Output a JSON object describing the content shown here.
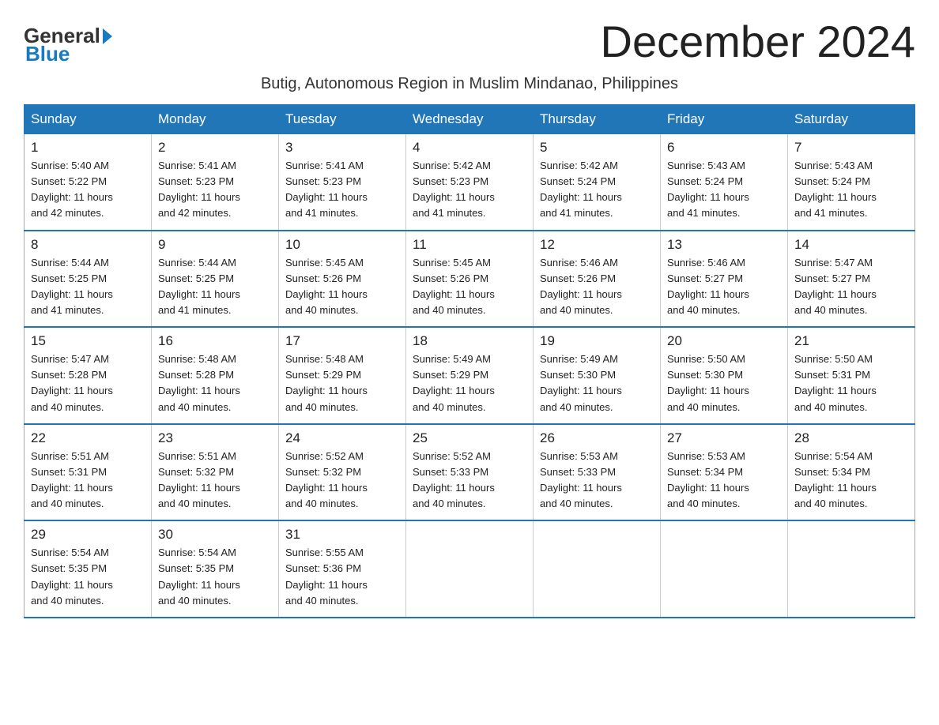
{
  "logo": {
    "general": "General",
    "blue": "Blue"
  },
  "title": "December 2024",
  "subtitle": "Butig, Autonomous Region in Muslim Mindanao, Philippines",
  "days_of_week": [
    "Sunday",
    "Monday",
    "Tuesday",
    "Wednesday",
    "Thursday",
    "Friday",
    "Saturday"
  ],
  "weeks": [
    [
      {
        "day": "1",
        "sunrise": "5:40 AM",
        "sunset": "5:22 PM",
        "daylight": "11 hours and 42 minutes."
      },
      {
        "day": "2",
        "sunrise": "5:41 AM",
        "sunset": "5:23 PM",
        "daylight": "11 hours and 42 minutes."
      },
      {
        "day": "3",
        "sunrise": "5:41 AM",
        "sunset": "5:23 PM",
        "daylight": "11 hours and 41 minutes."
      },
      {
        "day": "4",
        "sunrise": "5:42 AM",
        "sunset": "5:23 PM",
        "daylight": "11 hours and 41 minutes."
      },
      {
        "day": "5",
        "sunrise": "5:42 AM",
        "sunset": "5:24 PM",
        "daylight": "11 hours and 41 minutes."
      },
      {
        "day": "6",
        "sunrise": "5:43 AM",
        "sunset": "5:24 PM",
        "daylight": "11 hours and 41 minutes."
      },
      {
        "day": "7",
        "sunrise": "5:43 AM",
        "sunset": "5:24 PM",
        "daylight": "11 hours and 41 minutes."
      }
    ],
    [
      {
        "day": "8",
        "sunrise": "5:44 AM",
        "sunset": "5:25 PM",
        "daylight": "11 hours and 41 minutes."
      },
      {
        "day": "9",
        "sunrise": "5:44 AM",
        "sunset": "5:25 PM",
        "daylight": "11 hours and 41 minutes."
      },
      {
        "day": "10",
        "sunrise": "5:45 AM",
        "sunset": "5:26 PM",
        "daylight": "11 hours and 40 minutes."
      },
      {
        "day": "11",
        "sunrise": "5:45 AM",
        "sunset": "5:26 PM",
        "daylight": "11 hours and 40 minutes."
      },
      {
        "day": "12",
        "sunrise": "5:46 AM",
        "sunset": "5:26 PM",
        "daylight": "11 hours and 40 minutes."
      },
      {
        "day": "13",
        "sunrise": "5:46 AM",
        "sunset": "5:27 PM",
        "daylight": "11 hours and 40 minutes."
      },
      {
        "day": "14",
        "sunrise": "5:47 AM",
        "sunset": "5:27 PM",
        "daylight": "11 hours and 40 minutes."
      }
    ],
    [
      {
        "day": "15",
        "sunrise": "5:47 AM",
        "sunset": "5:28 PM",
        "daylight": "11 hours and 40 minutes."
      },
      {
        "day": "16",
        "sunrise": "5:48 AM",
        "sunset": "5:28 PM",
        "daylight": "11 hours and 40 minutes."
      },
      {
        "day": "17",
        "sunrise": "5:48 AM",
        "sunset": "5:29 PM",
        "daylight": "11 hours and 40 minutes."
      },
      {
        "day": "18",
        "sunrise": "5:49 AM",
        "sunset": "5:29 PM",
        "daylight": "11 hours and 40 minutes."
      },
      {
        "day": "19",
        "sunrise": "5:49 AM",
        "sunset": "5:30 PM",
        "daylight": "11 hours and 40 minutes."
      },
      {
        "day": "20",
        "sunrise": "5:50 AM",
        "sunset": "5:30 PM",
        "daylight": "11 hours and 40 minutes."
      },
      {
        "day": "21",
        "sunrise": "5:50 AM",
        "sunset": "5:31 PM",
        "daylight": "11 hours and 40 minutes."
      }
    ],
    [
      {
        "day": "22",
        "sunrise": "5:51 AM",
        "sunset": "5:31 PM",
        "daylight": "11 hours and 40 minutes."
      },
      {
        "day": "23",
        "sunrise": "5:51 AM",
        "sunset": "5:32 PM",
        "daylight": "11 hours and 40 minutes."
      },
      {
        "day": "24",
        "sunrise": "5:52 AM",
        "sunset": "5:32 PM",
        "daylight": "11 hours and 40 minutes."
      },
      {
        "day": "25",
        "sunrise": "5:52 AM",
        "sunset": "5:33 PM",
        "daylight": "11 hours and 40 minutes."
      },
      {
        "day": "26",
        "sunrise": "5:53 AM",
        "sunset": "5:33 PM",
        "daylight": "11 hours and 40 minutes."
      },
      {
        "day": "27",
        "sunrise": "5:53 AM",
        "sunset": "5:34 PM",
        "daylight": "11 hours and 40 minutes."
      },
      {
        "day": "28",
        "sunrise": "5:54 AM",
        "sunset": "5:34 PM",
        "daylight": "11 hours and 40 minutes."
      }
    ],
    [
      {
        "day": "29",
        "sunrise": "5:54 AM",
        "sunset": "5:35 PM",
        "daylight": "11 hours and 40 minutes."
      },
      {
        "day": "30",
        "sunrise": "5:54 AM",
        "sunset": "5:35 PM",
        "daylight": "11 hours and 40 minutes."
      },
      {
        "day": "31",
        "sunrise": "5:55 AM",
        "sunset": "5:36 PM",
        "daylight": "11 hours and 40 minutes."
      },
      null,
      null,
      null,
      null
    ]
  ],
  "sunrise_label": "Sunrise:",
  "sunset_label": "Sunset:",
  "daylight_label": "Daylight:"
}
